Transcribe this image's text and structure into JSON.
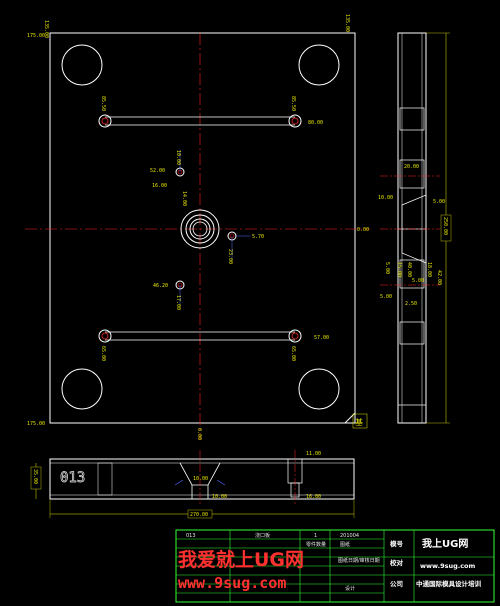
{
  "top_view": {
    "edge_labels": {
      "top_left": "175.00",
      "top_x1": "135.00",
      "top_x2": "135.00",
      "bottom_left": "175.00",
      "bottom_center": "0.00",
      "right_center": "0.00"
    },
    "holes": {
      "upper_left": "85.50",
      "upper_right": "85.50",
      "upper_pair_dim": "80.00",
      "mid_upper_a": "52.00",
      "mid_upper_b": "10.00",
      "mid_upper_c": "16.00",
      "mid_upper_d": "14.00",
      "sprue_right": "5.70",
      "sprue_below": "23.00",
      "mid_lower_a": "46.20",
      "mid_lower_b": "17.00",
      "lower_left": "65.00",
      "lower_right": "65.00",
      "lower_pair_dim": "57.00"
    },
    "corner_note": "基"
  },
  "side_view": {
    "height_dim": "250.00",
    "labels": [
      "10.00",
      "5.00",
      "5.00",
      "5.00",
      "18.00",
      "40.00",
      "5.00",
      "42.00",
      "20.00",
      "2.50",
      "15.00"
    ]
  },
  "bottom_view": {
    "engraving": "013",
    "height_dim": "35.00",
    "width_dim": "270.00",
    "labels": [
      "11.00",
      "16.00",
      "10.00",
      "10.00"
    ]
  },
  "title_block": {
    "part_no": "013",
    "name": "浇口板",
    "qty": "1",
    "qty_unit": "零件数量",
    "material_label": "模号",
    "material_value": "2000",
    "drawing_label": "图纸",
    "drawing_code": "201004",
    "check_label": "校对",
    "check_value": "图纸日期/审核日期",
    "design_label": "设计",
    "logo": "我上UG网",
    "company": "中通国际模具设计培训",
    "url": "www.9sug.com",
    "company_label": "公司",
    "drawing_date": "图纸日期"
  },
  "watermark": {
    "line1": "我爱就上UG网",
    "line2": "www.9sug.com"
  }
}
